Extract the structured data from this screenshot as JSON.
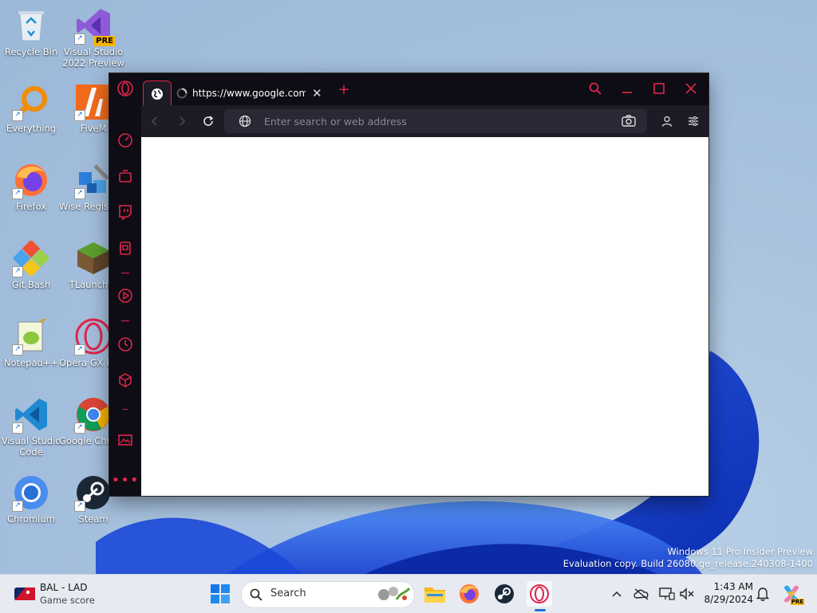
{
  "desktop": {
    "icons": [
      {
        "label": "Recycle Bin"
      },
      {
        "label": "Visual Studio 2022 Preview"
      },
      {
        "label": "Everything"
      },
      {
        "label": "FiveM"
      },
      {
        "label": "Firefox"
      },
      {
        "label": "Wise Registry Cleaner"
      },
      {
        "label": "Git Bash"
      },
      {
        "label": "TLauncher"
      },
      {
        "label": "Notepad++"
      },
      {
        "label": "Opera GX Browser"
      },
      {
        "label": "Visual Studio Code"
      },
      {
        "label": "Google Chrome"
      },
      {
        "label": "Chromium"
      },
      {
        "label": "Steam"
      }
    ],
    "vs_badge": "PRE"
  },
  "browser": {
    "tab_title": "https://www.google.com/search",
    "address_placeholder": "Enter search or web address",
    "accent": "#e0254b"
  },
  "watermark": {
    "line1": "Windows 11 Pro Insider Preview",
    "line2": "Evaluation copy. Build 26080.ge_release.240308-1400"
  },
  "taskbar": {
    "widget_title": "BAL - LAD",
    "widget_sub": "Game score",
    "search_placeholder": "Search",
    "time": "1:43 AM",
    "date": "8/29/2024",
    "copilot_badge": "PRE"
  }
}
